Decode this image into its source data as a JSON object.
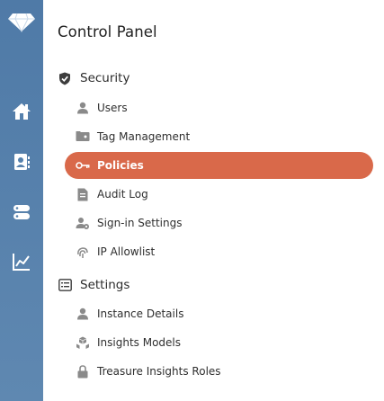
{
  "app": {
    "logo_icon": "diamond-logo",
    "accent_color": "#d9694a",
    "rail_color": "#5581ad"
  },
  "rail": {
    "items": [
      {
        "name": "home",
        "icon": "home-icon"
      },
      {
        "name": "profiles",
        "icon": "profiles-icon"
      },
      {
        "name": "databases",
        "icon": "database-icon"
      },
      {
        "name": "insights",
        "icon": "chart-icon"
      }
    ]
  },
  "panel": {
    "title": "Control Panel",
    "sections": [
      {
        "label": "Security",
        "icon": "shield-check-icon",
        "items": [
          {
            "label": "Users",
            "icon": "user-icon"
          },
          {
            "label": "Tag Management",
            "icon": "tags-icon"
          },
          {
            "label": "Policies",
            "icon": "key-icon",
            "active": true
          },
          {
            "label": "Audit Log",
            "icon": "document-icon"
          },
          {
            "label": "Sign-in Settings",
            "icon": "user-gear-icon"
          },
          {
            "label": "IP Allowlist",
            "icon": "fingerprint-icon"
          }
        ]
      },
      {
        "label": "Settings",
        "icon": "settings-panel-icon",
        "items": [
          {
            "label": "Instance Details",
            "icon": "user-icon"
          },
          {
            "label": "Insights Models",
            "icon": "cubes-icon"
          },
          {
            "label": "Treasure Insights Roles",
            "icon": "lock-icon"
          }
        ]
      }
    ]
  }
}
